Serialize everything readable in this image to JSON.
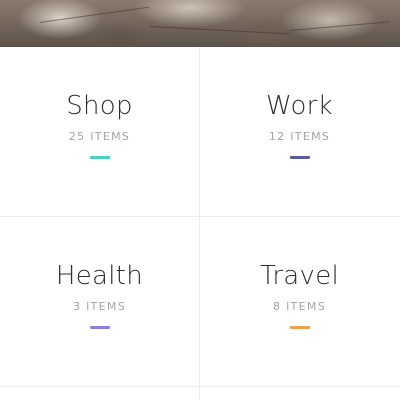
{
  "hero": {
    "image_icon": "dried-leaves-photo"
  },
  "categories": [
    {
      "title": "Shop",
      "count": "25 ITEMS",
      "accent": "#4ecdc4"
    },
    {
      "title": "Work",
      "count": "12 ITEMS",
      "accent": "#5b5a9c"
    },
    {
      "title": "Health",
      "count": "3 ITEMS",
      "accent": "#8c7fe0"
    },
    {
      "title": "Travel",
      "count": "8 ITEMS",
      "accent": "#f0a04b"
    }
  ],
  "colors": {
    "divider": "#ececec",
    "title_text": "#2c2c33",
    "count_text": "#a3a3a8"
  }
}
